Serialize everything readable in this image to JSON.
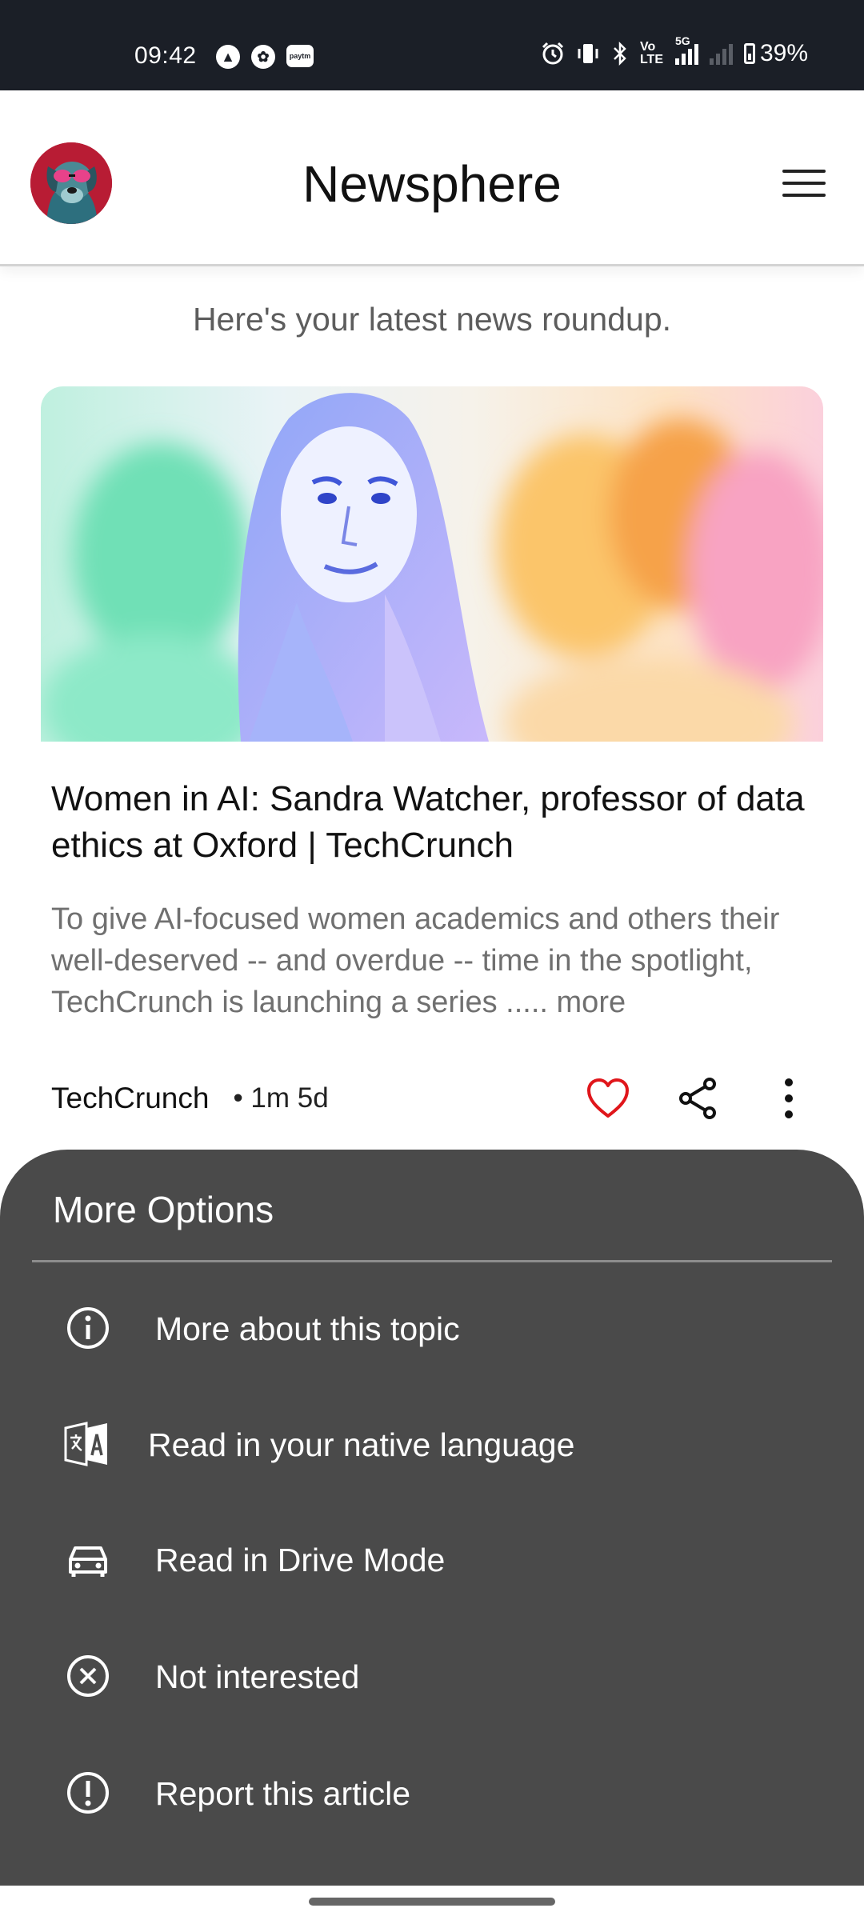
{
  "status_bar": {
    "time": "09:42",
    "network_label": "5G",
    "volte_label": "Vo LTE",
    "battery": "39%",
    "app_icons": [
      "nav-arrow-icon",
      "leaf-icon",
      "paytm-icon"
    ]
  },
  "header": {
    "title": "Newsphere",
    "avatar": "dog-with-sunglasses-avatar",
    "menu_icon": "hamburger-menu-icon"
  },
  "feed": {
    "subtitle": "Here's your latest news roundup."
  },
  "article": {
    "title": "Women in AI: Sandra Watcher, professor of data ethics at Oxford | TechCrunch",
    "description": "To give AI-focused women academics and others their well-deserved -- and overdue -- time in the spotlight, TechCrunch is launching a series ..... more",
    "source": "TechCrunch",
    "time": "• 1m 5d",
    "like_color": "#e0161b"
  },
  "sheet": {
    "title": "More Options",
    "options": [
      {
        "label": "More about this topic",
        "icon": "info-icon"
      },
      {
        "label": "Read in your native language",
        "icon": "translate-icon"
      },
      {
        "label": "Read in Drive Mode",
        "icon": "car-icon"
      },
      {
        "label": "Not interested",
        "icon": "close-circle-icon"
      },
      {
        "label": "Report this article",
        "icon": "alert-icon"
      }
    ]
  },
  "colors": {
    "sheet_background": "#4a4a4a",
    "status_bar": "#1b1f27"
  }
}
